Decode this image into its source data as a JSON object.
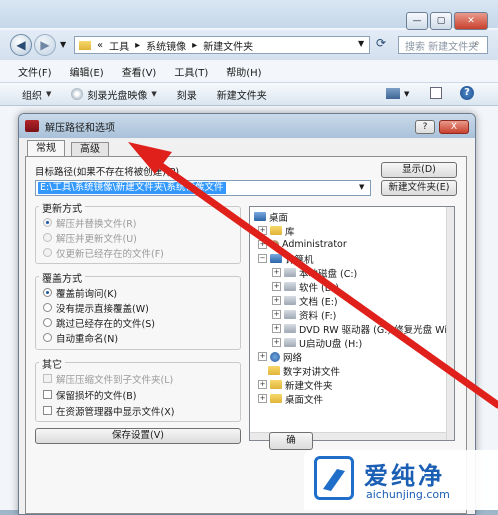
{
  "explorer": {
    "breadcrumb": [
      "«",
      "工具",
      "系统镜像",
      "新建文件夹"
    ],
    "search_placeholder": "搜索 新建文件夹",
    "menu": [
      "文件(F)",
      "编辑(E)",
      "查看(V)",
      "工具(T)",
      "帮助(H)"
    ],
    "toolbar": [
      "组织",
      "刻录光盘映像",
      "刻录",
      "新建文件夹"
    ]
  },
  "dialog": {
    "title": "解压路径和选项",
    "help_button": "?",
    "close_button": "X",
    "tabs": [
      "常规",
      "高级"
    ],
    "active_tab": 0,
    "target_label": "目标路径(如果不存在将被创建)(P)",
    "target_value": "E:\\工具\\系统镜像\\新建文件夹\\系统镜像文件",
    "display_button": "显示(D)",
    "new_folder_button": "新建文件夹(E)",
    "update_group": {
      "label": "更新方式",
      "options": [
        "解压并替换文件(R)",
        "解压并更新文件(U)",
        "仅更新已经存在的文件(F)"
      ],
      "selected": 0,
      "disabled": true
    },
    "overwrite_group": {
      "label": "覆盖方式",
      "options": [
        "覆盖前询问(K)",
        "没有提示直接覆盖(W)",
        "跳过已经存在的文件(S)",
        "自动重命名(N)"
      ],
      "selected": 0
    },
    "other_group": {
      "label": "其它",
      "options": [
        {
          "label": "解压压缩文件到子文件夹(L)",
          "checked": false,
          "disabled": true
        },
        {
          "label": "保留损坏的文件(B)",
          "checked": false,
          "disabled": false
        },
        {
          "label": "在资源管理器中显示文件(X)",
          "checked": false,
          "disabled": false
        }
      ]
    },
    "save_settings_button": "保存设置(V)",
    "ok_button": "确",
    "tree": [
      {
        "label": "桌面",
        "level": 0,
        "icon": "desktop-icon"
      },
      {
        "label": "库",
        "level": 1,
        "icon": "library-icon"
      },
      {
        "label": "Administrator",
        "level": 1,
        "icon": "user-icon"
      },
      {
        "label": "计算机",
        "level": 1,
        "icon": "computer-icon"
      },
      {
        "label": "本地磁盘 (C:)",
        "level": 2,
        "icon": "drive-icon"
      },
      {
        "label": "软件 (D:)",
        "level": 2,
        "icon": "drive-icon"
      },
      {
        "label": "文档 (E:)",
        "level": 2,
        "icon": "drive-icon"
      },
      {
        "label": "资料 (F:)",
        "level": 2,
        "icon": "drive-icon"
      },
      {
        "label": "DVD RW 驱动器 (G:) 修复光盘 Wi",
        "level": 2,
        "icon": "dvd-icon"
      },
      {
        "label": "U启动U盘 (H:)",
        "level": 2,
        "icon": "usb-drive-icon"
      },
      {
        "label": "网络",
        "level": 1,
        "icon": "network-icon"
      },
      {
        "label": "数字对讲文件",
        "level": 1,
        "icon": "folder-icon"
      },
      {
        "label": "新建文件夹",
        "level": 1,
        "icon": "folder-icon"
      },
      {
        "label": "桌面文件",
        "level": 1,
        "icon": "folder-icon"
      }
    ]
  },
  "watermark": {
    "title": "爱纯净",
    "url": "aichunjing.com"
  },
  "colors": {
    "selection": "#3399ff",
    "arrow": "#e0201b",
    "title_gradient": "#a9c1d9"
  }
}
